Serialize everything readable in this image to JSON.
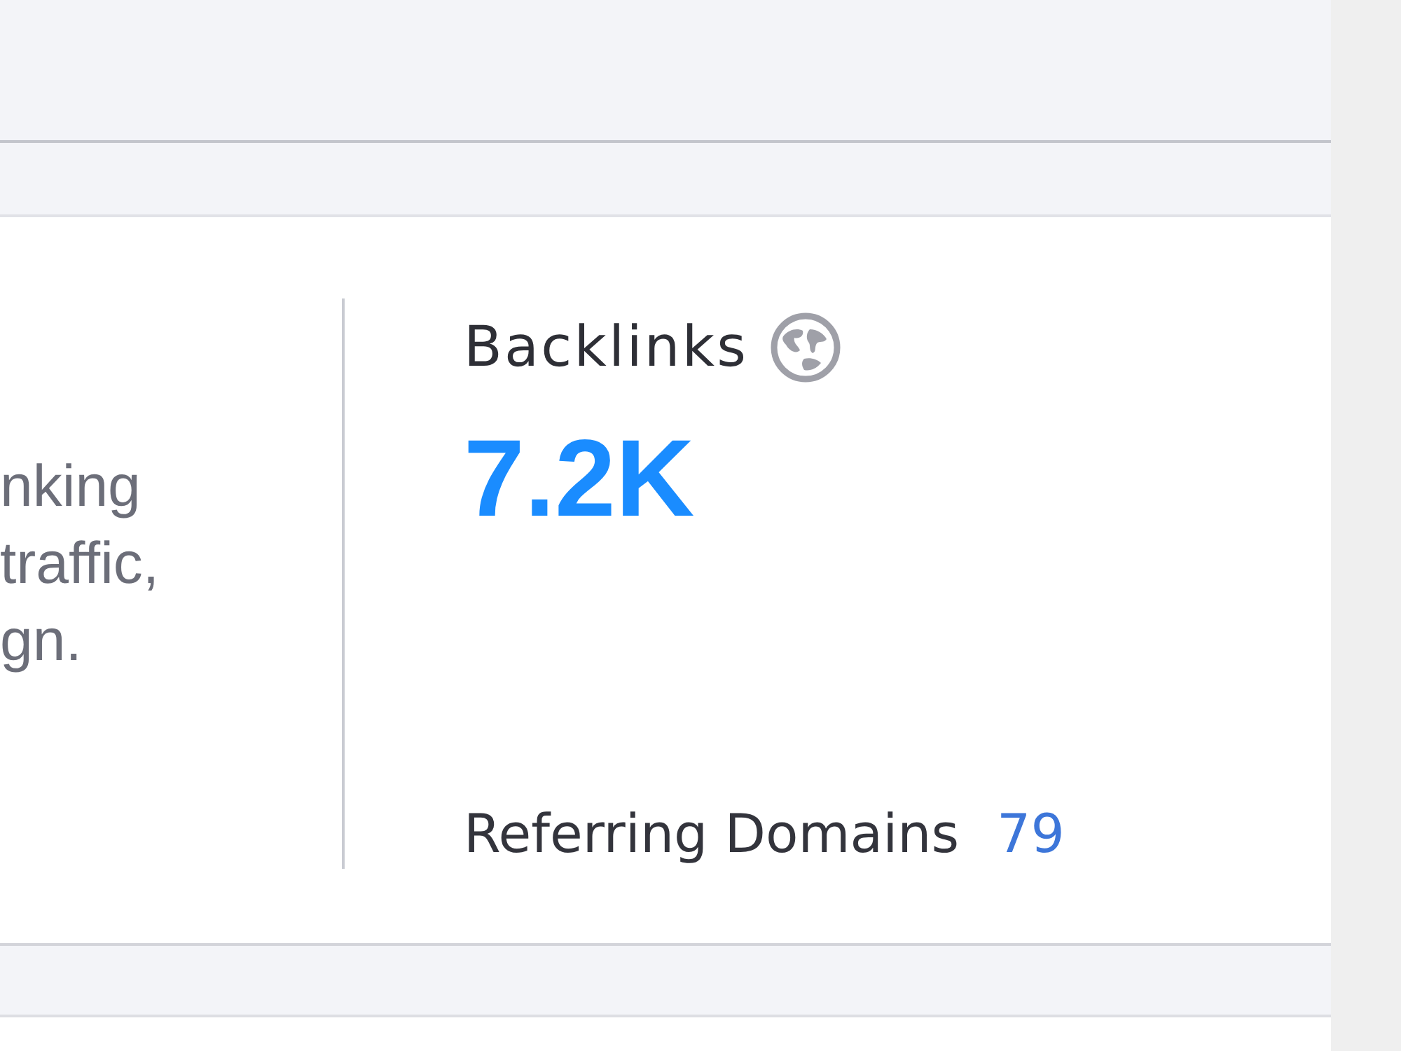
{
  "description": {
    "lines": [
      "nking",
      "traffic,",
      "gn."
    ]
  },
  "metric": {
    "title": "Backlinks",
    "value": "7.2K",
    "footer": {
      "label": "Referring Domains",
      "value": "79"
    }
  }
}
